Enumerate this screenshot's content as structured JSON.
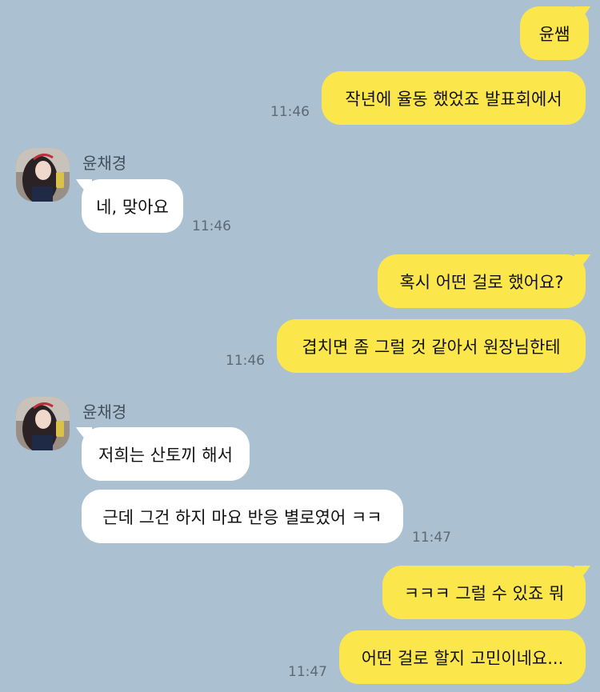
{
  "messages": {
    "m1": "윤쌤",
    "m2": "작년에 율동 했었죠 발표회에서",
    "m3": "네, 맞아요",
    "m4": "혹시 어떤 걸로 했어요?",
    "m5": "겹치면 좀 그럴 것 같아서 원장님한테",
    "m6": "저희는 산토끼 해서",
    "m7": "근데 그건 하지 마요 반응 별로였어 ㅋㅋ",
    "m8": "ㅋㅋㅋ 그럴 수 있죠 뭐",
    "m9": "어떤 걸로 할지 고민이네요..."
  },
  "times": {
    "t1": "11:46",
    "t2": "11:46",
    "t3": "11:46",
    "t4": "11:47",
    "t5": "11:47"
  },
  "sender": {
    "name": "윤채경",
    "avatar": "profile-photo"
  },
  "colors": {
    "background": "#abc1d1",
    "outgoing_bubble": "#fbe64c",
    "incoming_bubble": "#ffffff"
  }
}
